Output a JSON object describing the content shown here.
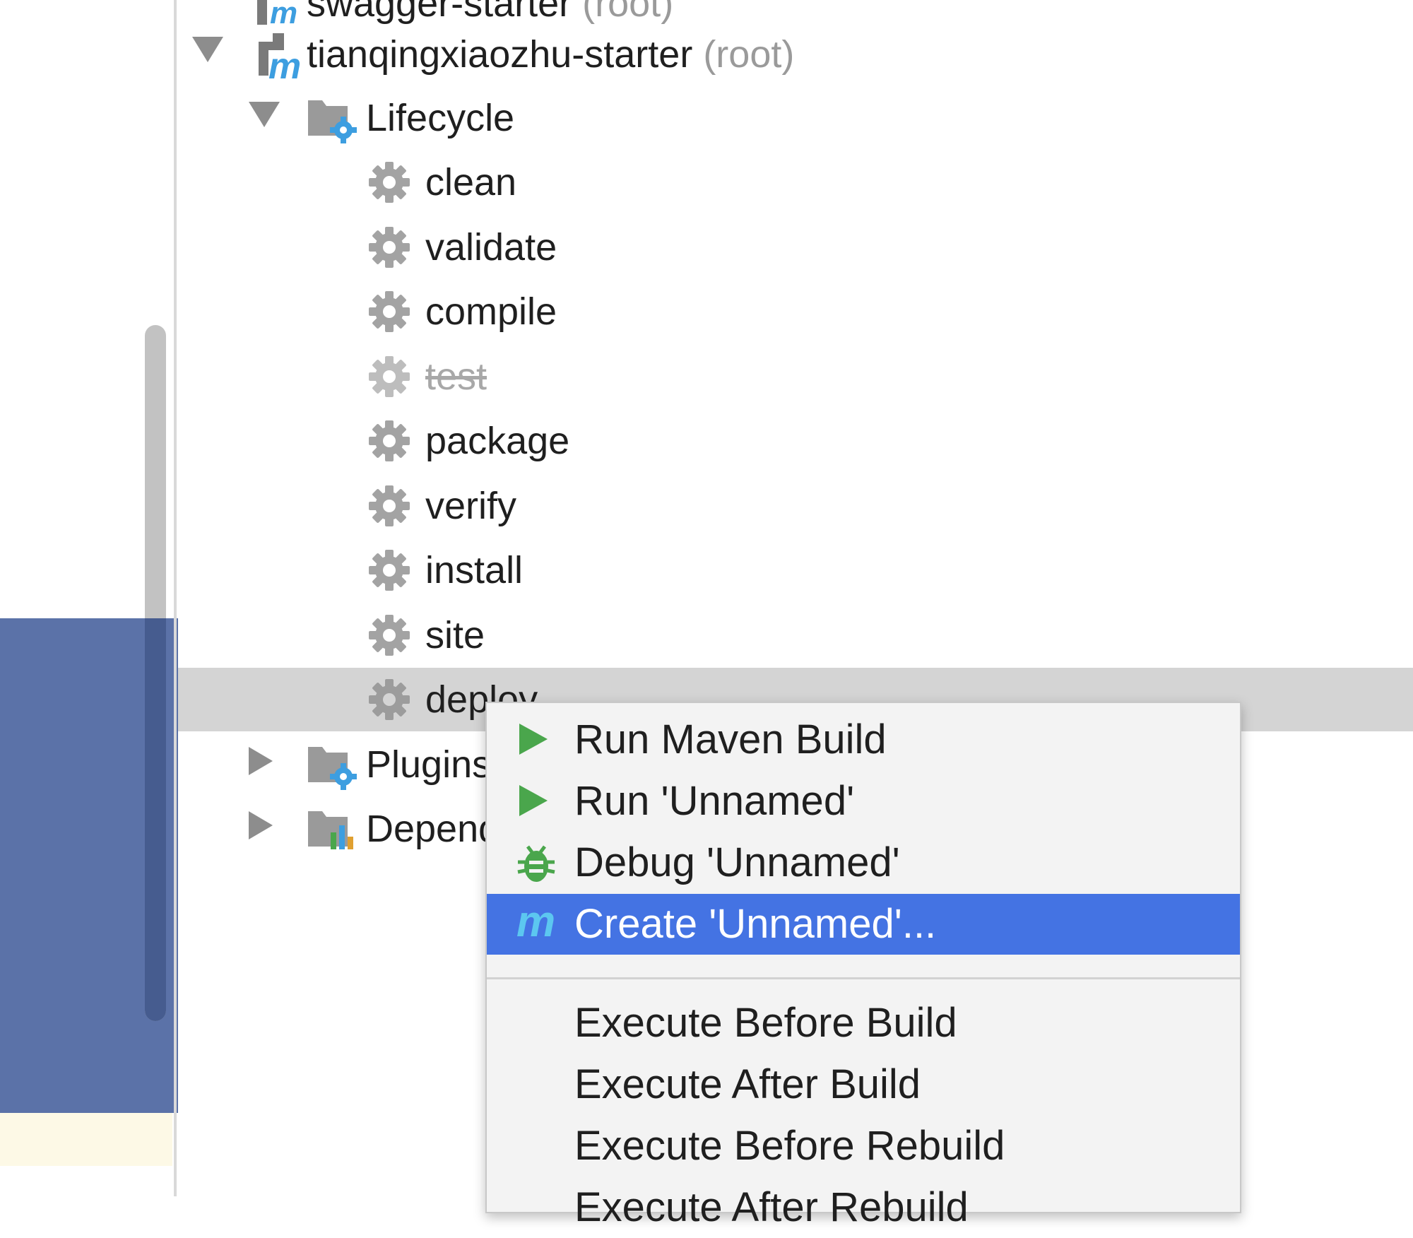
{
  "tree": {
    "partial_top": {
      "name": "swagger-starter",
      "suffix": "(root)"
    },
    "project": {
      "name": "tianqingxiaozhu-starter",
      "suffix": "(root)"
    },
    "lifecycle": {
      "label": "Lifecycle",
      "phases": [
        "clean",
        "validate",
        "compile",
        "test",
        "package",
        "verify",
        "install",
        "site",
        "deploy"
      ]
    },
    "plugins_label": "Plugins",
    "dependencies_label": "Dependencies"
  },
  "context_menu": {
    "items": [
      {
        "label": "Run Maven Build",
        "icon": "run-icon"
      },
      {
        "label": "Run 'Unnamed'",
        "icon": "run-icon"
      },
      {
        "label": "Debug 'Unnamed'",
        "icon": "debug-icon"
      },
      {
        "label": "Create 'Unnamed'...",
        "icon": "maven-icon",
        "highlighted": true
      },
      {
        "label": "Execute Before Build"
      },
      {
        "label": "Execute After Build"
      },
      {
        "label": "Execute Before Rebuild"
      },
      {
        "label": "Execute After Rebuild"
      }
    ]
  },
  "colors": {
    "selection_row": "#d4d4d4",
    "menu_highlight": "#4473e3",
    "run_green": "#4aa64c",
    "maven_blue": "#3d9ee0",
    "left_panel_blue": "#5b72a8"
  }
}
